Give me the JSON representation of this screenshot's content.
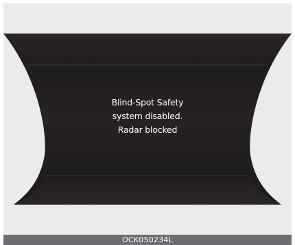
{
  "display": {
    "message_lines": [
      "Blind-Spot Safety",
      "system disabled.",
      "Radar blocked"
    ],
    "background_color": "#ebebeb",
    "screen_color": "#231f20",
    "text_color": "#ffffff"
  },
  "caption": {
    "code": "OCK050234L",
    "bar_color": "#6d6e71"
  }
}
